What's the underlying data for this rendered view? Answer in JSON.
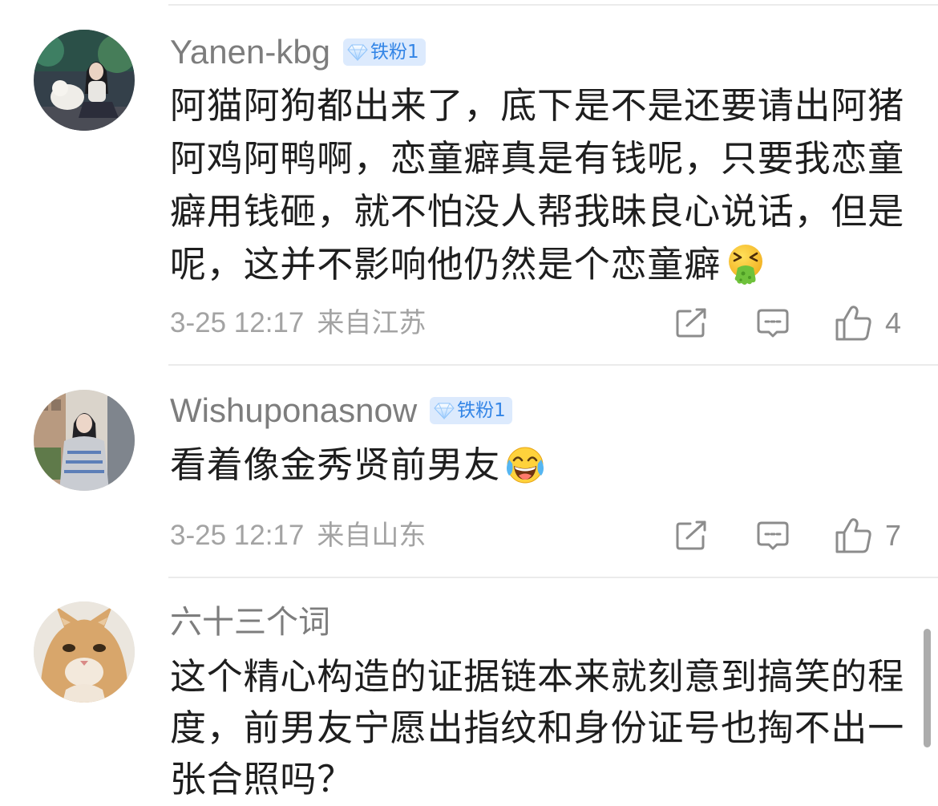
{
  "comments": [
    {
      "username": "Yanen-kbg",
      "badge": {
        "label": "铁粉1",
        "icon": "diamond-icon"
      },
      "text_lines": [
        "阿猫阿狗都出来了，底下是不是还要请出阿猪",
        "阿鸡阿鸭啊，恋童癖真是有钱呢，只要我恋童",
        "癖用钱砸，就不怕没人帮我昧良心说话，但是",
        "呢，这并不影响他仍然是个恋童癖"
      ],
      "emoji": "vomiting-face-emoji",
      "time": "3-25 12:17",
      "location": "来自江苏",
      "likes": 4
    },
    {
      "username": "Wishuponasnow",
      "badge": {
        "label": "铁粉1",
        "icon": "diamond-icon"
      },
      "text_lines": [
        "看着像金秀贤前男友"
      ],
      "emoji": "laughing-crying-emoji",
      "time": "3-25 12:17",
      "location": "来自山东",
      "likes": 7
    },
    {
      "username": "六十三个词",
      "text_lines": [
        "这个精心构造的证据链本来就刻意到搞笑的程",
        "度，前男友宁愿出指纹和身份证号也掏不出一",
        "张合照吗？"
      ]
    }
  ],
  "actions": {
    "repost_icon": "share-icon",
    "reply_icon": "comment-icon",
    "like_icon": "thumbs-up-icon"
  },
  "colors": {
    "background": "#ffffff",
    "text": "#1e1e1e",
    "username": "#7d7d7d",
    "meta": "#a3a3a3",
    "icon": "#8c8c8c",
    "divider": "#ebebeb",
    "badge_background": "#dceafd",
    "badge_text": "#3385e6",
    "scrollbar": "#acacac"
  }
}
